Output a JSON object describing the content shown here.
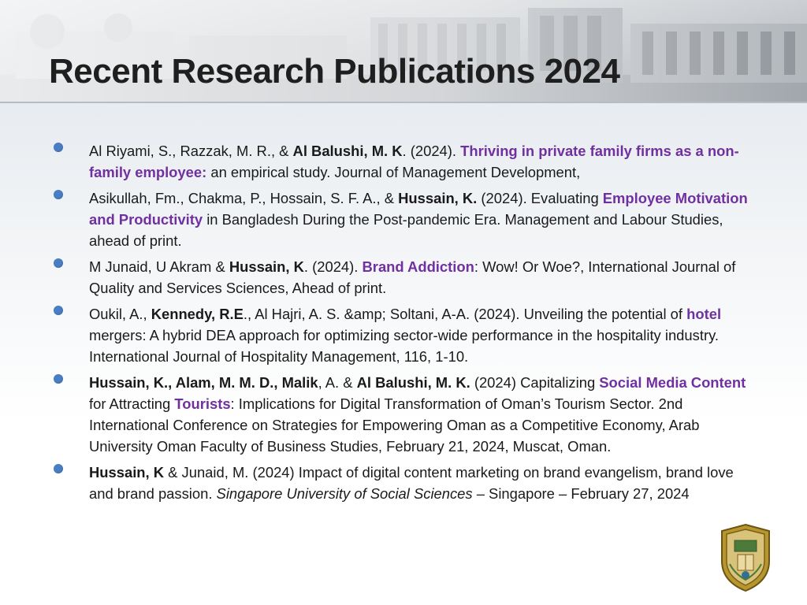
{
  "slide": {
    "title": "Recent Research Publications 2024"
  },
  "colors": {
    "bullet": "#4a7ec4",
    "highlight": "#7030a0",
    "text": "#1a1a1a",
    "title": "#1f1f1f"
  },
  "publications": [
    {
      "segments": [
        {
          "t": "Al Riyami, S., Razzak, M. R., & "
        },
        {
          "t": "Al Balushi, M. K",
          "s": "b"
        },
        {
          "t": ". (2024). "
        },
        {
          "t": "Thriving in private family firms as a non-family employee:",
          "s": "hl"
        },
        {
          "t": " an empirical study. Journal of Management Development,"
        }
      ]
    },
    {
      "segments": [
        {
          "t": "Asikullah, Fm., Chakma, P., Hossain, S. F. A., & "
        },
        {
          "t": "Hussain, K.",
          "s": "b"
        },
        {
          "t": " (2024). Evaluating "
        },
        {
          "t": "Employee Motivation and Productivity",
          "s": "hl"
        },
        {
          "t": " in Bangladesh During the Post-pandemic Era. Management and Labour Studies, ahead of print."
        }
      ]
    },
    {
      "segments": [
        {
          "t": "M Junaid, U Akram & "
        },
        {
          "t": "Hussain, K",
          "s": "b"
        },
        {
          "t": ". (2024). "
        },
        {
          "t": "Brand Addiction",
          "s": "hl"
        },
        {
          "t": ": Wow! Or Woe?, International Journal of Quality and Services Sciences, Ahead of print."
        }
      ]
    },
    {
      "segments": [
        {
          "t": "Oukil, A., "
        },
        {
          "t": "Kennedy, R.E",
          "s": "b"
        },
        {
          "t": "., Al Hajri, A. S. &amp; Soltani, A-A. (2024). Unveiling the potential of "
        },
        {
          "t": "hotel",
          "s": "hl"
        },
        {
          "t": " mergers: A hybrid DEA approach for optimizing sector-wide performance in the hospitality industry. International Journal of Hospitality Management, 116, 1-10."
        }
      ]
    },
    {
      "segments": [
        {
          "t": "Hussain, K., Alam, M. M. D., Malik",
          "s": "b"
        },
        {
          "t": ", A. & "
        },
        {
          "t": "Al Balushi, M. K.",
          "s": "b"
        },
        {
          "t": " (2024) Capitalizing "
        },
        {
          "t": "Social Media Content",
          "s": "hl"
        },
        {
          "t": " for Attracting "
        },
        {
          "t": "Tourists",
          "s": "hl"
        },
        {
          "t": ": Implications for Digital Transformation of Oman’s Tourism Sector. 2nd International Conference on Strategies for Empowering Oman as a Competitive Economy, Arab University Oman Faculty of Business Studies, February 21, 2024, Muscat, Oman."
        }
      ]
    },
    {
      "segments": [
        {
          "t": "Hussain, K",
          "s": "b"
        },
        {
          "t": " & Junaid, M. (2024) Impact of digital content marketing on brand evangelism, brand love and brand passion. "
        },
        {
          "t": "Singapore University of Social Sciences",
          "s": "i"
        },
        {
          "t": " – Singapore – February 27, 2024"
        }
      ]
    }
  ],
  "logo": {
    "icon": "university-crest-icon"
  }
}
